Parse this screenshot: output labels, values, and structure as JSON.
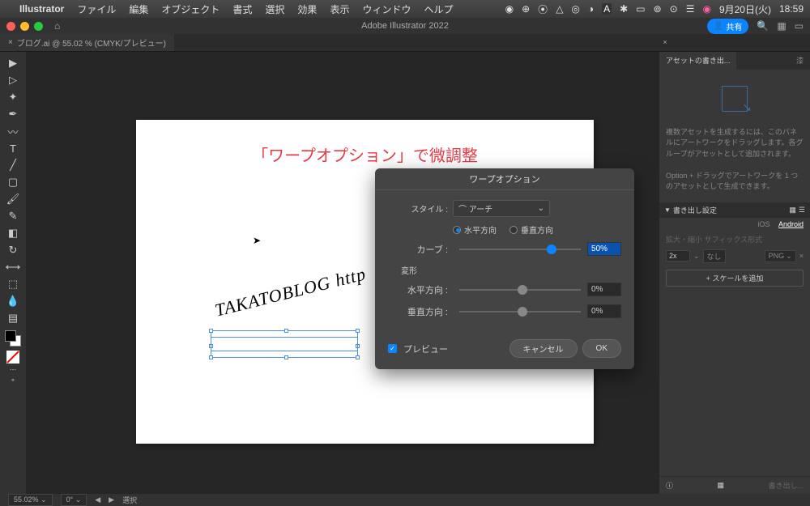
{
  "menubar": {
    "apple": "",
    "app": "Illustrator",
    "items": [
      "ファイル",
      "編集",
      "オブジェクト",
      "書式",
      "選択",
      "効果",
      "表示",
      "ウィンドウ",
      "ヘルプ"
    ],
    "date": "9月20日(火)",
    "time": "18:59"
  },
  "titlebar": {
    "title": "Adobe Illustrator 2022",
    "share": "共有"
  },
  "tab": {
    "label": "ブログ.ai @ 55.02 % (CMYK/プレビュー)"
  },
  "artboard": {
    "heading": "「ワープオプション」で微調整",
    "curved": "TAKATOBLOG  http"
  },
  "dialog": {
    "title": "ワープオプション",
    "style_label": "スタイル :",
    "style_value": "アーチ",
    "radio_h": "水平方向",
    "radio_v": "垂直方向",
    "curve_label": "カーブ :",
    "curve_value": "50%",
    "deform_label": "変形",
    "hdist_label": "水平方向 :",
    "hdist_value": "0%",
    "vdist_label": "垂直方向 :",
    "vdist_value": "0%",
    "preview": "プレビュー",
    "cancel": "キャンセル",
    "ok": "OK"
  },
  "panel": {
    "tab1": "アセットの書き出...",
    "tab2": "漆",
    "help1": "複数アセットを生成するには、このパネルにアートワークをドラッグします。各グループがアセットとして追加されます。",
    "help2": "Option + ドラッグでアートワークを 1 つのアセットとして生成できます。",
    "section": "書き出し設定",
    "ios": "iOS",
    "android": "Android",
    "scale_hdr": "拡大・縮小  サフィックス形式",
    "scale_x": "2x",
    "suffix": "なし",
    "format": "PNG",
    "add_scale": "+ スケールを追加",
    "export": "書き出し..."
  },
  "statusbar": {
    "zoom": "55.02%",
    "rotation": "0°",
    "mode": "選択"
  }
}
